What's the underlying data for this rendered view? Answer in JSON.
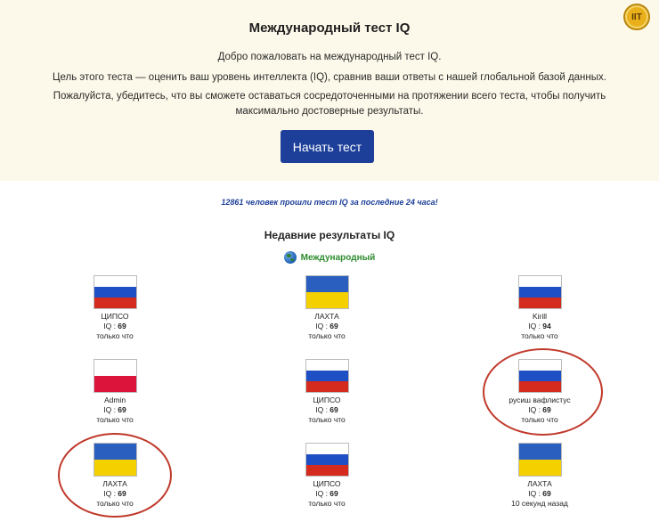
{
  "header": {
    "title": "Международный тест IQ",
    "welcome": "Добро пожаловать на международный тест IQ.",
    "goal": "Цель этого теста — оценить ваш уровень интеллекта (IQ), сравнив ваши ответы с нашей глобальной базой данных.",
    "focus": "Пожалуйста, убедитесь, что вы сможете оставаться сосредоточенными на протяжении всего теста, чтобы получить максимально достоверные результаты.",
    "start_button": "Начать тест",
    "logo_text": "IIT"
  },
  "stats": {
    "taken_note": "12861 человек прошли тест IQ за последние 24 часа!"
  },
  "results": {
    "title": "Недавние результаты IQ",
    "region_icon": "globe-icon",
    "region_label": "Международный",
    "iq_prefix": "IQ : ",
    "items": [
      {
        "name": "ЦИПСО",
        "iq": "69",
        "time": "только что",
        "flag": "russia-flag"
      },
      {
        "name": "ЛАХТА",
        "iq": "69",
        "time": "только что",
        "flag": "ukraine-flag"
      },
      {
        "name": "Kirill",
        "iq": "94",
        "time": "только что",
        "flag": "russia-flag"
      },
      {
        "name": "Admin",
        "iq": "69",
        "time": "только что",
        "flag": "poland-flag"
      },
      {
        "name": "ЦИПСО",
        "iq": "69",
        "time": "только что",
        "flag": "russia-flag"
      },
      {
        "name": "русиш вафлистус",
        "iq": "69",
        "time": "только что",
        "flag": "russia-flag"
      },
      {
        "name": "ЛАХТА",
        "iq": "69",
        "time": "только что",
        "flag": "ukraine-flag"
      },
      {
        "name": "ЦИПСО",
        "iq": "69",
        "time": "только что",
        "flag": "russia-flag"
      },
      {
        "name": "ЛАХТА",
        "iq": "69",
        "time": "10 секунд назад",
        "flag": "ukraine-flag"
      }
    ]
  },
  "colors": {
    "hero_bg": "#fdf9ea",
    "button_bg": "#1d3f9a",
    "note_color": "#1d3f9a",
    "region_color": "#2e8b2e",
    "annotation_circle": "#c0392b"
  }
}
